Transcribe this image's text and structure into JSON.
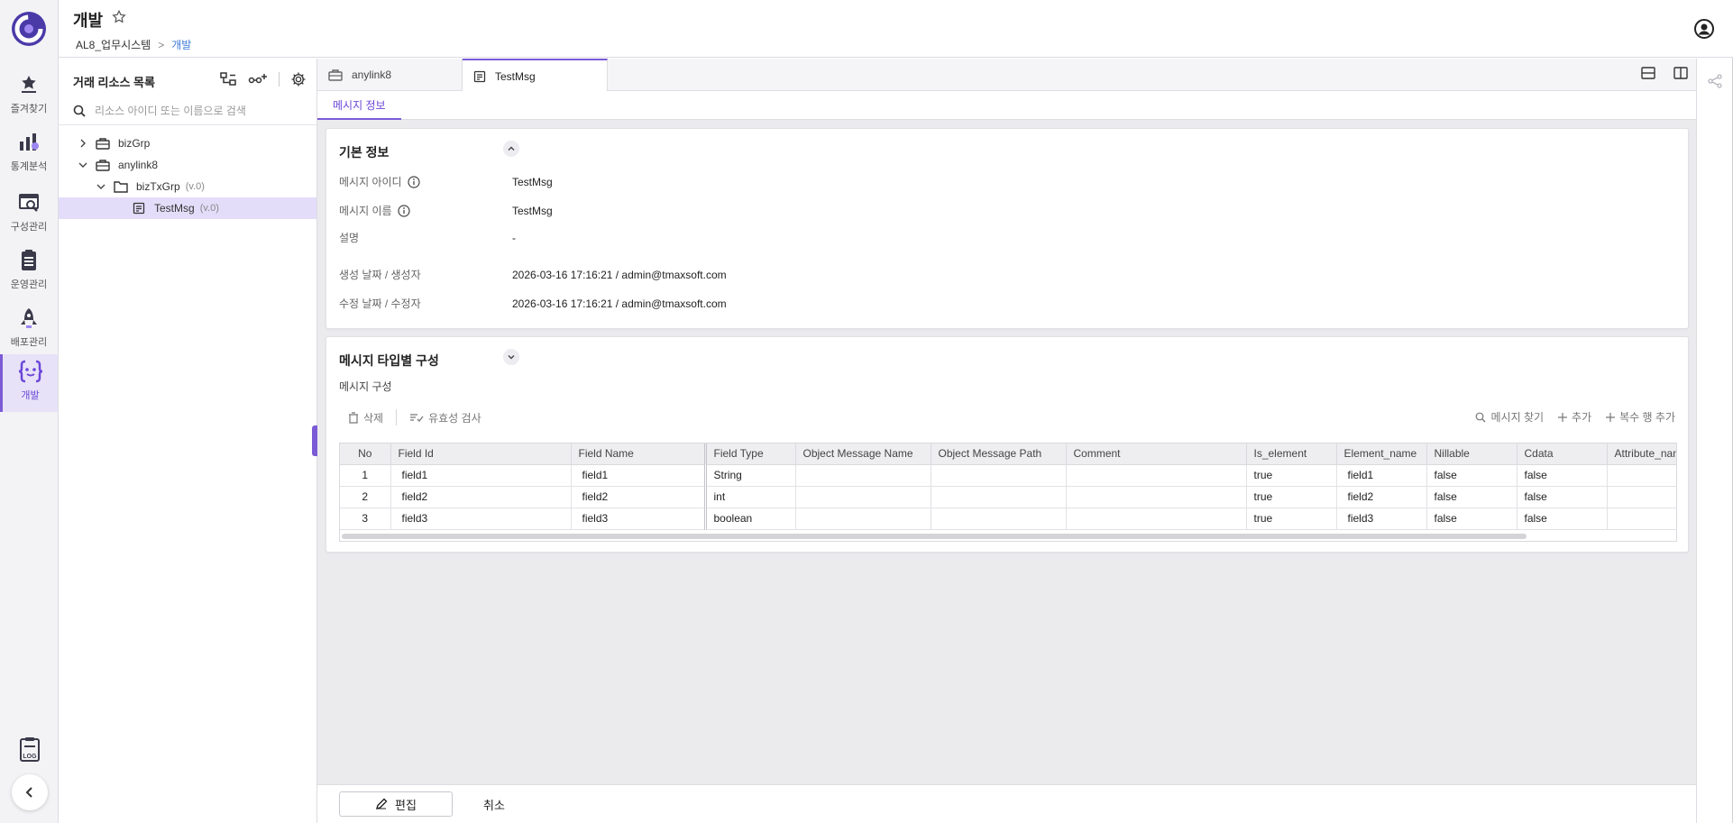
{
  "header": {
    "title": "개발",
    "breadcrumb": {
      "root": "AL8_업무시스템",
      "separator": ">",
      "current": "개발"
    }
  },
  "left_nav": {
    "items": [
      {
        "label": "즐겨찾기",
        "icon": "star-list-icon"
      },
      {
        "label": "통계분석",
        "icon": "chart-icon"
      },
      {
        "label": "구성관리",
        "icon": "config-search-icon"
      },
      {
        "label": "운영관리",
        "icon": "clipboard-icon"
      },
      {
        "label": "배포관리",
        "icon": "rocket-icon"
      },
      {
        "label": "개발",
        "icon": "code-braces-icon",
        "active": true
      }
    ],
    "bottom": {
      "log_icon": "log-icon",
      "collapse_icon": "chevron-left-icon"
    }
  },
  "sidebar": {
    "title": "거래 리소스 목록",
    "search_placeholder": "리소스 아이디 또는 이름으로 검색",
    "tree": [
      {
        "label": "bizGrp",
        "version": "",
        "level": 0,
        "expanded": false,
        "icon": "briefcase-icon"
      },
      {
        "label": "anylink8",
        "version": "",
        "level": 0,
        "expanded": true,
        "icon": "briefcase-icon"
      },
      {
        "label": "bizTxGrp",
        "version": "(v.0)",
        "level": 1,
        "expanded": true,
        "icon": "folder-icon"
      },
      {
        "label": "TestMsg",
        "version": "(v.0)",
        "level": 2,
        "selected": true,
        "icon": "message-doc-icon"
      }
    ]
  },
  "tabs": [
    {
      "label": "anylink8",
      "icon": "briefcase-icon"
    },
    {
      "label": "TestMsg",
      "icon": "message-doc-icon",
      "active": true
    }
  ],
  "subtab": "메시지 정보",
  "basic_info": {
    "title": "기본 정보",
    "rows": [
      {
        "label": "메시지 아이디",
        "value": "TestMsg",
        "info": true
      },
      {
        "label": "메시지 이름",
        "value": "TestMsg",
        "info": true
      },
      {
        "label": "설명",
        "value": "-"
      },
      {
        "label": "생성 날짜 / 생성자",
        "value": "2026-03-16 17:16:21 / admin@tmaxsoft.com"
      },
      {
        "label": "수정 날짜 / 수정자",
        "value": "2026-03-16 17:16:21 / admin@tmaxsoft.com"
      }
    ]
  },
  "type_config": {
    "title": "메시지 타입별 구성",
    "sub_label": "메시지 구성",
    "toolbar": {
      "delete": "삭제",
      "validate": "유효성 검사",
      "find": "메시지 찾기",
      "add": "추가",
      "add_multiple": "복수 행 추가"
    },
    "columns": [
      "No",
      "Field Id",
      "Field Name",
      "Field Type",
      "Object Message Name",
      "Object Message Path",
      "Comment",
      "Is_element",
      "Element_name",
      "Nillable",
      "Cdata",
      "Attribute_name"
    ],
    "rows": [
      [
        "1",
        "field1",
        "field1",
        "String",
        "",
        "",
        "",
        "true",
        "field1",
        "false",
        "false",
        ""
      ],
      [
        "2",
        "field2",
        "field2",
        "int",
        "",
        "",
        "",
        "true",
        "field2",
        "false",
        "false",
        ""
      ],
      [
        "3",
        "field3",
        "field3",
        "boolean",
        "",
        "",
        "",
        "true",
        "field3",
        "false",
        "false",
        ""
      ]
    ]
  },
  "footer": {
    "edit": "편집",
    "cancel": "취소"
  },
  "colors": {
    "accent": "#7b5bd6",
    "link": "#3d7bd8"
  }
}
